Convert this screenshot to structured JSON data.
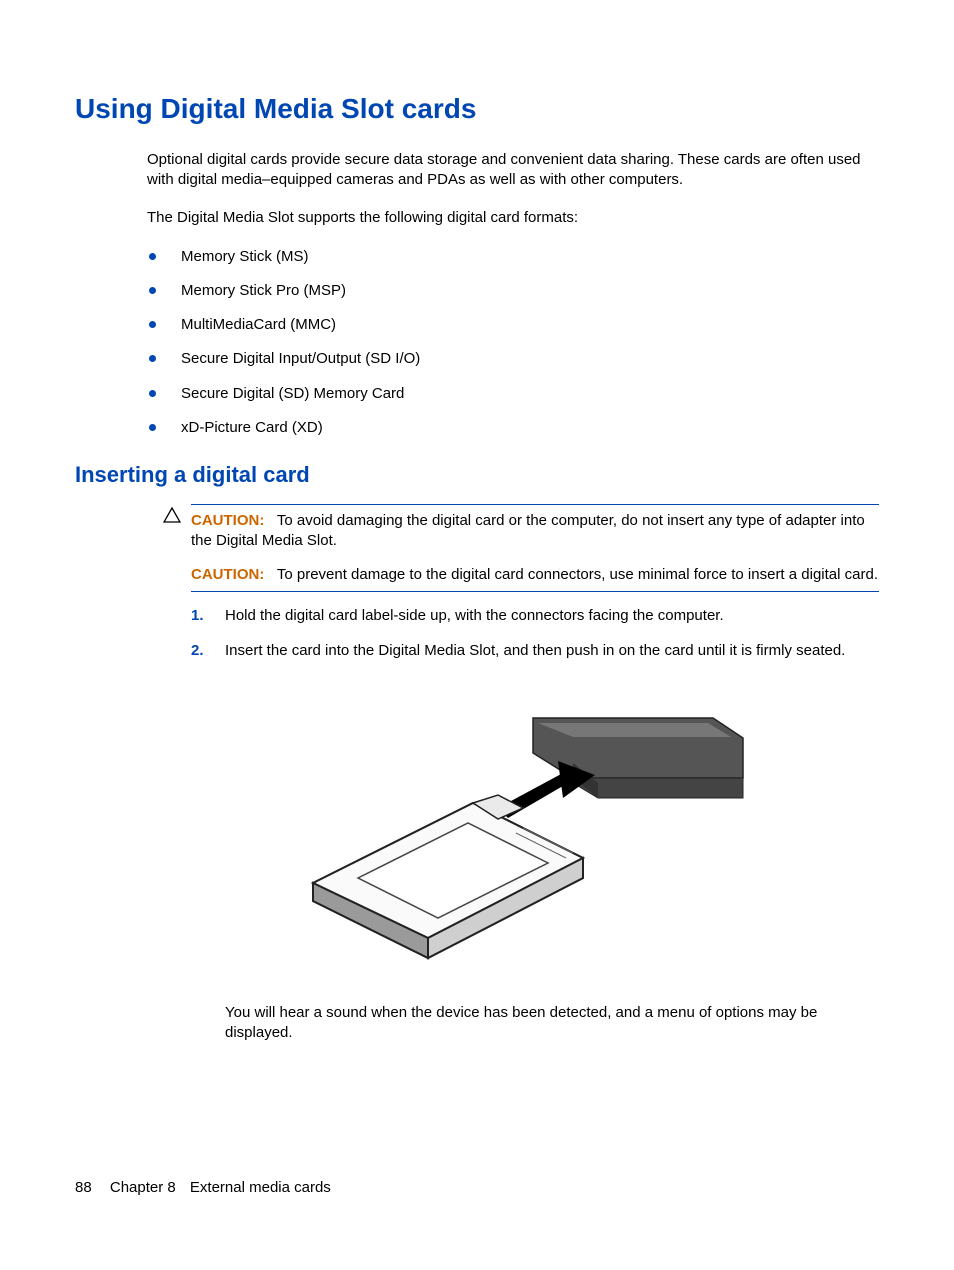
{
  "heading1": "Using Digital Media Slot cards",
  "intro_p1": "Optional digital cards provide secure data storage and convenient data sharing. These cards are often used with digital media–equipped cameras and PDAs as well as with other computers.",
  "intro_p2": "The Digital Media Slot supports the following digital card formats:",
  "formats": [
    "Memory Stick (MS)",
    "Memory Stick Pro (MSP)",
    "MultiMediaCard (MMC)",
    "Secure Digital Input/Output (SD I/O)",
    "Secure Digital (SD) Memory Card",
    "xD-Picture Card (XD)"
  ],
  "heading2": "Inserting a digital card",
  "caution_label": "CAUTION:",
  "caution1_text": "To avoid damaging the digital card or the computer, do not insert any type of adapter into the Digital Media Slot.",
  "caution2_text": "To prevent damage to the digital card connectors, use minimal force to insert a digital card.",
  "steps": [
    {
      "num": "1.",
      "text": "Hold the digital card label-side up, with the connectors facing the computer."
    },
    {
      "num": "2.",
      "text": "Insert the card into the Digital Media Slot, and then push in on the card until it is firmly seated."
    }
  ],
  "post_text": "You will hear a sound when the device has been detected, and a menu of options may be displayed.",
  "footer": {
    "page_number": "88",
    "chapter_label": "Chapter 8",
    "chapter_title": "External media cards"
  }
}
